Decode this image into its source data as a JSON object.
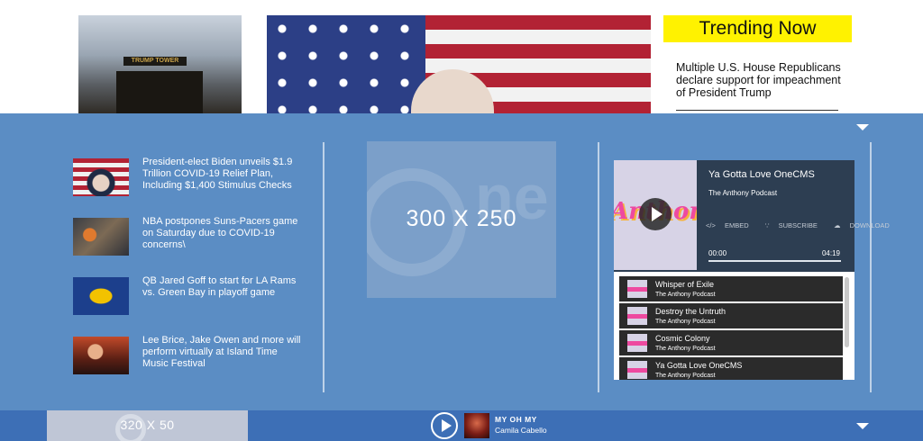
{
  "top": {
    "building_sign": "TRUMP TOWER",
    "trending_heading": "Trending Now",
    "trending_items": [
      "Multiple U.S. House Republicans declare support for impeachment of President Trump"
    ]
  },
  "news": [
    {
      "title": "President-elect Biden unveils $1.9 Trillion COVID-19 Relief Plan, Including $1,400 Stimulus Checks",
      "thumb": "biden-flag-photo"
    },
    {
      "title": "NBA postpones Suns-Pacers game on Saturday due to COVID-19 concerns\\",
      "thumb": "basketball-photo"
    },
    {
      "title": "QB Jared Goff to start for LA Rams vs. Green Bay in playoff game",
      "thumb": "rams-logo"
    },
    {
      "title": "Lee Brice, Jake Owen and more will perform virtually at Island Time Music Festival",
      "thumb": "concert-photo"
    }
  ],
  "ads": {
    "large_label": "300 X 250",
    "small_label": "320 X 50",
    "watermark": "ne"
  },
  "podcast": {
    "art_text": "Anthony",
    "episode_title": "Ya Gotta Love OneCMS",
    "show_name": "The Anthony Podcast",
    "actions": {
      "embed": "EMBED",
      "subscribe": "SUBSCRIBE",
      "download": "DOWNLOAD"
    },
    "current_time": "00:00",
    "duration": "04:19",
    "progress_fraction": 0.0,
    "tracks": [
      {
        "title": "Whisper of Exile",
        "show": "The Anthony Podcast"
      },
      {
        "title": "Destroy the Untruth",
        "show": "The Anthony Podcast"
      },
      {
        "title": "Cosmic Colony",
        "show": "The Anthony Podcast"
      },
      {
        "title": "Ya Gotta Love OneCMS",
        "show": "The Anthony Podcast"
      }
    ]
  },
  "now_playing": {
    "title": "MY OH MY",
    "artist": "Camila Cabello"
  },
  "colors": {
    "overlay_blue": "#5b8dc4",
    "bottom_bar_blue": "#3d6fb6",
    "trending_yellow": "#fff200",
    "player_dark": "#2d3e52"
  }
}
